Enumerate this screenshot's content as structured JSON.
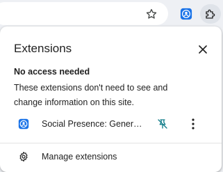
{
  "toolbar": {
    "icons": {
      "star": "star-icon",
      "extension": "social-presence-icon",
      "extensions_menu": "puzzle-icon"
    }
  },
  "popup": {
    "title": "Extensions",
    "section_heading": "No access needed",
    "section_desc": "These extensions don't need to see and change information on this site.",
    "extensions": [
      {
        "name": "Social Presence: Generator",
        "pinned": false
      }
    ],
    "manage_label": "Manage extensions"
  },
  "colors": {
    "accent": "#0b57d0",
    "pin_teal": "#127d8a",
    "text": "#1f1f1f"
  }
}
